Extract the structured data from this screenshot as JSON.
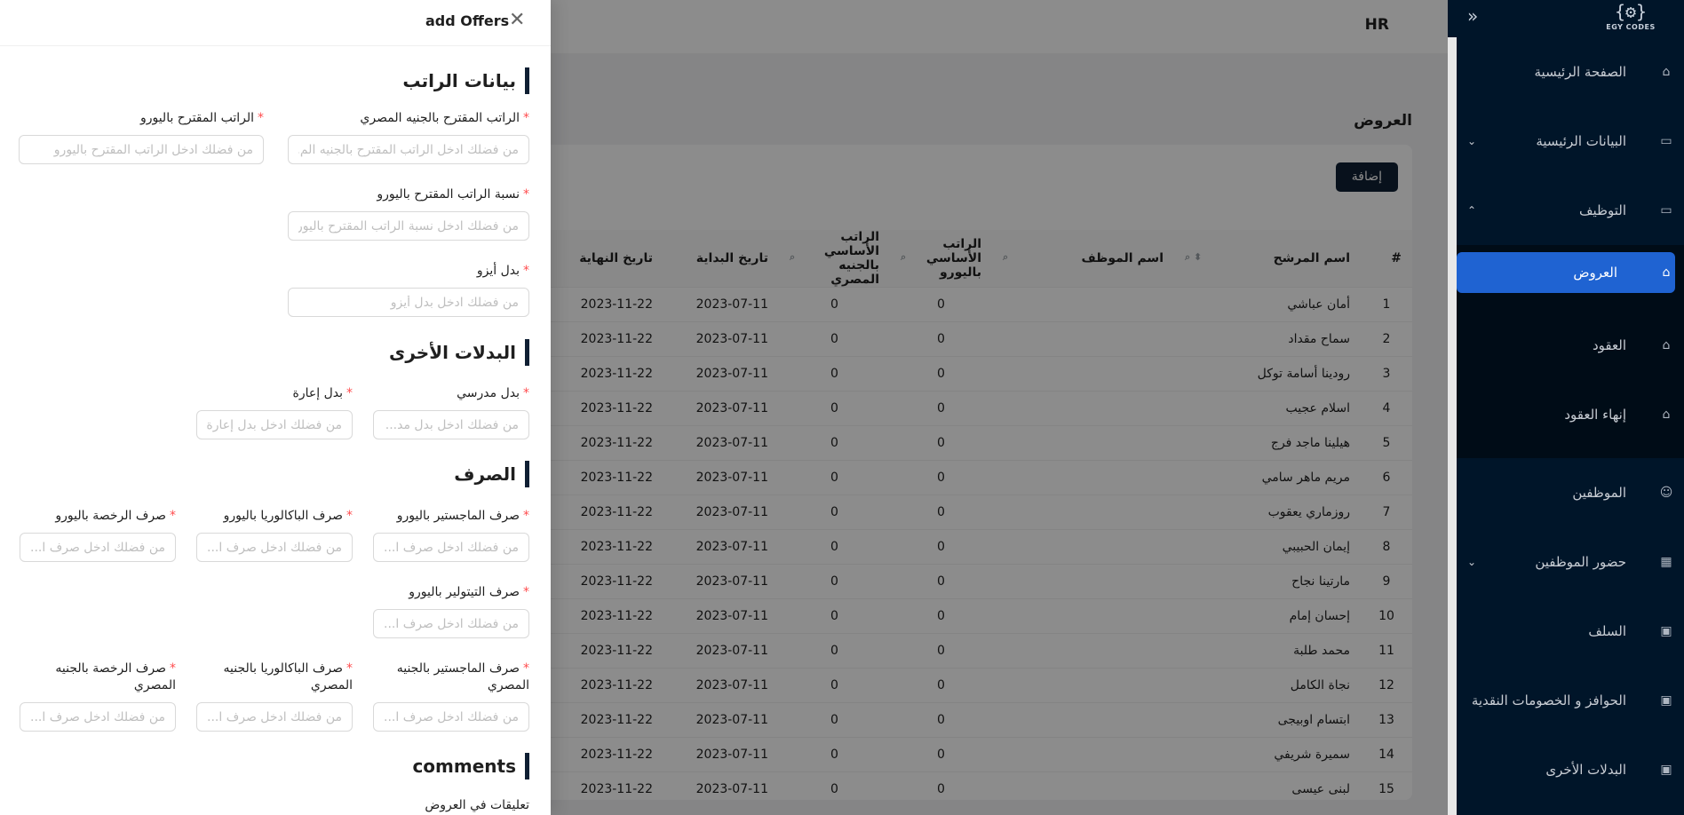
{
  "app": {
    "title": "HR",
    "logo_text": "EGY CODES"
  },
  "sidebar": {
    "items": [
      {
        "label": "الصفحة الرئيسية",
        "icon": "home-icon",
        "arrow": ""
      },
      {
        "label": "البيانات الرئيسية",
        "icon": "id-card-icon",
        "arrow": "⌄"
      },
      {
        "label": "التوظيف",
        "icon": "id-card-icon",
        "arrow": "⌃"
      }
    ],
    "submenu": [
      {
        "label": "العروض",
        "icon": "bank-icon",
        "active": true
      },
      {
        "label": "العقود",
        "icon": "bank-icon"
      },
      {
        "label": "إنهاء العقود",
        "icon": "bank-icon"
      }
    ],
    "items_after": [
      {
        "label": "الموظفين",
        "icon": "user-icon",
        "arrow": ""
      },
      {
        "label": "حضور الموظفين",
        "icon": "calendar-icon",
        "arrow": "⌄"
      },
      {
        "label": "السلف",
        "icon": "wallet-icon",
        "arrow": ""
      },
      {
        "label": "الحوافز و الخصومات النقدية",
        "icon": "wallet-icon",
        "arrow": ""
      },
      {
        "label": "البدلات الأخرى",
        "icon": "wallet-icon",
        "arrow": ""
      }
    ]
  },
  "page": {
    "title": "العروض",
    "add_button": "إضافة"
  },
  "table": {
    "columns": [
      "#",
      "اسم المرشح",
      "اسم الموظف",
      "الراتب الأساسي باليورو",
      "الراتب الأساسي بالجنيه المصري",
      "تاريخ البداية",
      "تاريخ النهاية"
    ],
    "rows": [
      [
        "1",
        "أمان عباشي",
        "",
        "0",
        "0",
        "2023-07-11",
        "2023-11-22"
      ],
      [
        "2",
        "سماح مقداد",
        "",
        "0",
        "0",
        "2023-07-11",
        "2023-11-22"
      ],
      [
        "3",
        "رودينا أسامة توكل",
        "",
        "0",
        "0",
        "2023-07-11",
        "2023-11-22"
      ],
      [
        "4",
        "اسلام عجيب",
        "",
        "0",
        "0",
        "2023-07-11",
        "2023-11-22"
      ],
      [
        "5",
        "هيلينا ماجد فرج",
        "",
        "0",
        "0",
        "2023-07-11",
        "2023-11-22"
      ],
      [
        "6",
        "مريم ماهر سامي",
        "",
        "0",
        "0",
        "2023-07-11",
        "2023-11-22"
      ],
      [
        "7",
        "روزماري يعقوب",
        "",
        "0",
        "0",
        "2023-07-11",
        "2023-11-22"
      ],
      [
        "8",
        "إيمان الحبيبي",
        "",
        "0",
        "0",
        "2023-07-11",
        "2023-11-22"
      ],
      [
        "9",
        "مارتينا نجاح",
        "",
        "0",
        "0",
        "2023-07-11",
        "2023-11-22"
      ],
      [
        "10",
        "إحسان إمام",
        "",
        "0",
        "0",
        "2023-07-11",
        "2023-11-22"
      ],
      [
        "11",
        "محمد طلبة",
        "",
        "0",
        "0",
        "2023-07-11",
        "2023-11-22"
      ],
      [
        "12",
        "نجاة الكامل",
        "",
        "0",
        "0",
        "2023-07-11",
        "2023-11-22"
      ],
      [
        "13",
        "ابتسام اوبيجى",
        "",
        "0",
        "0",
        "2023-07-11",
        "2023-11-22"
      ],
      [
        "14",
        "سميرة شريفي",
        "",
        "0",
        "0",
        "2023-07-11",
        "2023-11-22"
      ],
      [
        "15",
        "لبنى عيسى",
        "",
        "0",
        "0",
        "2023-07-11",
        "2023-11-22"
      ]
    ]
  },
  "drawer": {
    "title": "add Offers",
    "sections": {
      "salary": "بيانات الراتب",
      "other_allowances": "البدلات الأخرى",
      "exchange": "الصرف",
      "comments": "comments"
    },
    "fields": {
      "salary_egp": {
        "label": "الراتب المقترح بالجنيه المصري",
        "placeholder": "من فضلك ادخل الراتب المقترح بالجنيه الم..."
      },
      "salary_eur": {
        "label": "الراتب المقترح باليورو",
        "placeholder": "من فضلك ادخل الراتب المقترح باليورو"
      },
      "salary_eur_ratio": {
        "label": "نسبة الراتب المقترح باليورو",
        "placeholder": "من فضلك ادخل نسبة الراتب المقترح باليورو"
      },
      "izo_allowance": {
        "label": "بدل أيزو",
        "placeholder": "من فضلك ادخل بدل أيزو"
      },
      "teacher_allowance": {
        "label": "بدل مدرسي",
        "placeholder": "من فضلك ادخل بدل مد..."
      },
      "loan_allowance": {
        "label": "بدل إعارة",
        "placeholder": "من فضلك ادخل بدل إعارة"
      },
      "masters_eur": {
        "label": "صرف الماجستير باليورو",
        "placeholder": "من فضلك ادخل صرف ا..."
      },
      "bachelor_eur": {
        "label": "صرف الباكالوريا باليورو",
        "placeholder": "من فضلك ادخل صرف ا..."
      },
      "license_eur": {
        "label": "صرف الرخصة باليورو",
        "placeholder": "من فضلك ادخل صرف ا..."
      },
      "tutor_eur": {
        "label": "صرف التيتولير باليورو",
        "placeholder": "من فضلك ادخل صرف ا..."
      },
      "masters_egp": {
        "label": "صرف الماجستير بالجنيه المصري",
        "placeholder": "من فضلك ادخل صرف ا..."
      },
      "bachelor_egp": {
        "label": "صرف الباكالوريا بالجنيه المصري",
        "placeholder": "من فضلك ادخل صرف ا..."
      },
      "license_egp": {
        "label": "صرف الرخصة بالجنيه المصري",
        "placeholder": "من فضلك ادخل صرف ا..."
      },
      "comments": {
        "label": "تعليقات في العروض"
      }
    }
  },
  "colors": {
    "sidebar_bg": "#001529",
    "active": "#1f63d2",
    "primary_dark": "#0f1f33",
    "required": "#ff4d4f"
  }
}
